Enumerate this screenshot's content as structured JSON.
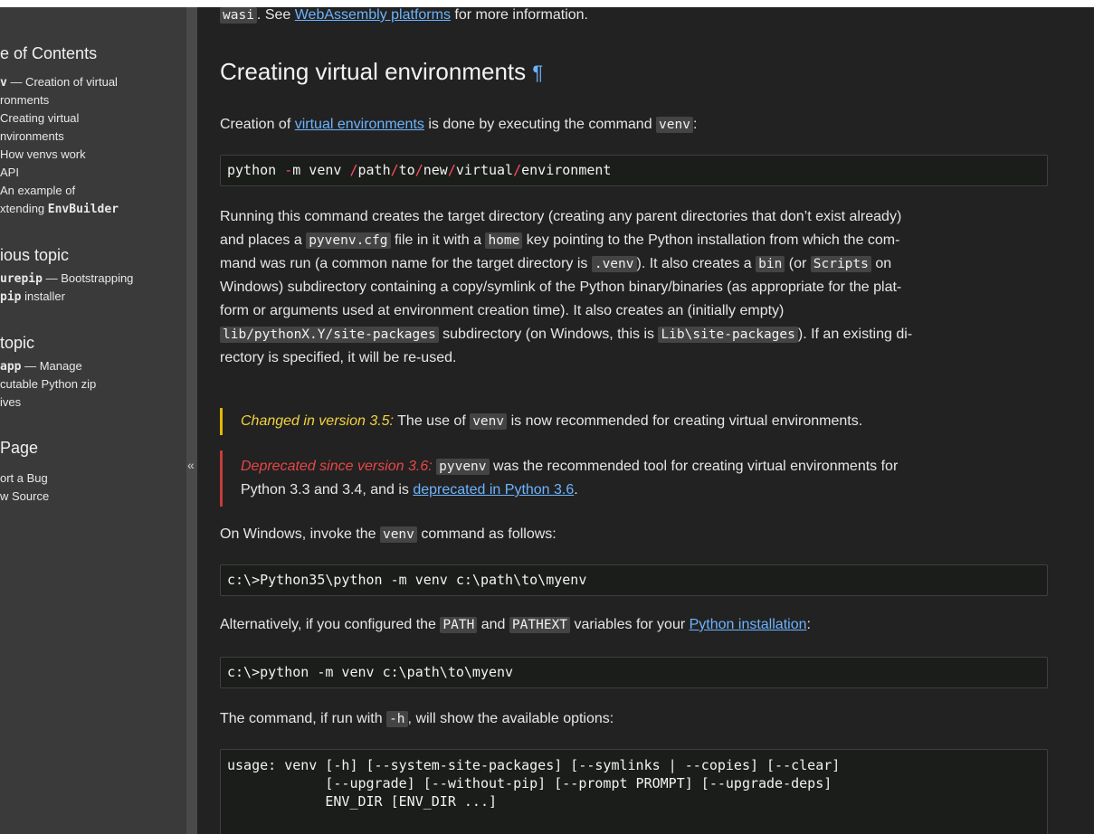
{
  "sidebar": {
    "toc_title": "e of Contents",
    "toc_items": [
      {
        "code": "v",
        "text": " — Creation of virtual"
      },
      {
        "text": "ronments"
      },
      {
        "text": "Creating virtual"
      },
      {
        "text": "nvironments"
      },
      {
        "text": "How venvs work"
      },
      {
        "text": "API"
      },
      {
        "text": "An example of"
      },
      {
        "text": "xtending ",
        "code": "EnvBuilder"
      }
    ],
    "prev_title": "ious topic",
    "prev_items": [
      {
        "code": "urepip",
        "text": " — Bootstrapping"
      },
      {
        "code": "pip",
        "text": " installer"
      }
    ],
    "next_title": " topic",
    "next_items": [
      {
        "code": "app",
        "text": " — Manage"
      },
      {
        "text": "cutable Python zip"
      },
      {
        "text": "ives"
      }
    ],
    "page_title": " Page",
    "page_items": [
      "ort a Bug",
      "w Source"
    ],
    "collapse_label": "«"
  },
  "main": {
    "top_line": {
      "code": "wasi",
      "text1": ". See ",
      "link": "WebAssembly platforms",
      "text2": " for more information."
    },
    "heading": "Creating virtual environments",
    "pilcrow": "¶",
    "intro": {
      "text1": "Creation of ",
      "link": "virtual environments",
      "text2": " is done by executing the command ",
      "code": "venv",
      "text3": ":"
    },
    "cmd1": [
      "python ",
      "-",
      "m venv ",
      "/",
      "path",
      "/",
      "to",
      "/",
      "new",
      "/",
      "virtual",
      "/",
      "environment"
    ],
    "para_lines": [
      "Running this command creates the target directory (creating any parent directories that don’t exist already)",
      [
        "and places a ",
        "pyvenv.cfg",
        " file in it with a ",
        "home",
        " key pointing to the Python installation from which the com-"
      ],
      [
        "mand was run (a common name for the target directory is ",
        ".venv",
        "). It also creates a ",
        "bin",
        " (or ",
        "Scripts",
        " on"
      ],
      "Windows) subdirectory containing a copy/symlink of the Python binary/binaries (as appropriate for the plat-",
      "form or arguments used at environment creation time). It also creates an (initially empty)",
      [
        "",
        "lib/pythonX.Y/site-packages",
        " subdirectory (on Windows, this is ",
        "Lib\\site-packages",
        "). If an existing di-"
      ],
      "rectory is specified, it will be re-used."
    ],
    "changed": {
      "label": "Changed in version 3.5:",
      "text1": " The use of ",
      "code": "venv",
      "text2": " is now recommended for creating virtual environments."
    },
    "deprecated": {
      "label": "Deprecated since version 3.6:",
      "code": "pyvenv",
      "text1": " was the recommended tool for creating virtual environments for",
      "text2": "Python 3.3 and 3.4, and is ",
      "link": "deprecated in Python 3.6",
      "text3": "."
    },
    "windows_para": {
      "text1": "On Windows, invoke the ",
      "code": "venv",
      "text2": " command as follows:"
    },
    "cmd2": "c:\\>Python35\\python -m venv c:\\path\\to\\myenv",
    "alt_para": {
      "text1": "Alternatively, if you configured the ",
      "code1": "PATH",
      "text2": " and ",
      "code2": "PATHEXT",
      "text3": " variables for your ",
      "link": "Python installation",
      "text4": ":"
    },
    "cmd3": "c:\\>python -m venv c:\\path\\to\\myenv",
    "help_para": {
      "text1": "The command, if run with ",
      "code": "-h",
      "text2": ", will show the available options:"
    },
    "usage_lines": [
      "usage: venv [-h] [--system-site-packages] [--symlinks | --copies] [--clear]",
      "            [--upgrade] [--without-pip] [--prompt PROMPT] [--upgrade-deps]",
      "            ENV_DIR [ENV_DIR ...]"
    ]
  }
}
